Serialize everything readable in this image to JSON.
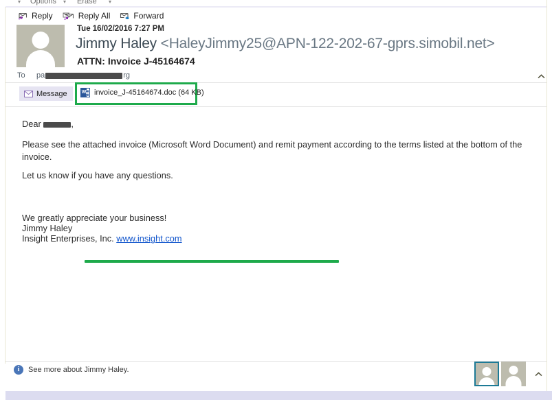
{
  "window": {
    "cut_toolbar_items": [
      "Options",
      "Erase"
    ]
  },
  "toolbar": {
    "reply_label": "Reply",
    "reply_all_label": "Reply All",
    "forward_label": "Forward"
  },
  "header": {
    "timestamp": "Tue 16/02/2016 7:27 PM",
    "sender_name": "Jimmy Haley",
    "sender_address": "<HaleyJimmy25@APN-122-202-67-gprs.simobil.net>",
    "subject": "ATTN: Invoice J-45164674",
    "to_label": "To",
    "to_recipient_prefix": "pa",
    "to_recipient_suffix": "rg"
  },
  "attachments": {
    "message_tab_label": "Message",
    "file_label": "invoice_J-45164674.doc (64 KB)"
  },
  "body": {
    "greeting_prefix": "Dear",
    "greeting_suffix": ",",
    "paragraph": "Please see the attached invoice (Microsoft Word Document) and remit payment according to the terms listed at the bottom of the invoice.",
    "questions": "Let us know if you have any questions.",
    "closing": "We greatly appreciate your business!",
    "signature_name": "Jimmy Haley",
    "signature_company": "Insight Enterprises, Inc.",
    "signature_link": "www.insight.com"
  },
  "footer": {
    "see_more_label": "See more about Jimmy Haley.",
    "info_glyph": "i"
  },
  "annotations": {
    "highlight_color": "#1eaa4b"
  },
  "icons": {
    "reply": "reply-icon",
    "reply_all": "reply-all-icon",
    "forward": "forward-icon",
    "envelope": "envelope-icon",
    "word_doc": "word-document-icon",
    "word_letter": "W",
    "chevron_up": "chevron-up-icon",
    "info": "info-icon"
  }
}
